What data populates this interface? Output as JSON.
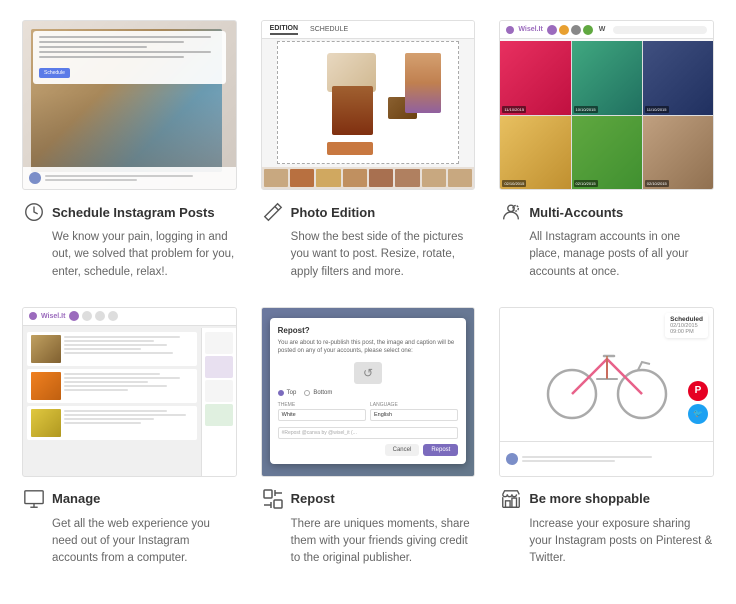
{
  "features": [
    {
      "id": "schedule",
      "title": "Schedule Instagram Posts",
      "description": "We know your pain, logging in and out, we solved that problem for you, enter, schedule, relax!.",
      "icon": "clock-icon"
    },
    {
      "id": "photo-edition",
      "title": "Photo Edition",
      "description": "Show the best side of the pictures you want to post. Resize, rotate, apply filters and more.",
      "icon": "pencil-icon",
      "tab_edition": "EDITION",
      "tab_schedule": "SCHEDULE"
    },
    {
      "id": "multi-accounts",
      "title": "Multi-Accounts",
      "description": "All Instagram accounts in one place, manage posts of all your accounts at once.",
      "icon": "person-icon",
      "brand": "Wisel.It"
    },
    {
      "id": "manage",
      "title": "Manage",
      "description": "Get all the web experience you need out of your Instagram accounts from a computer.",
      "icon": "monitor-icon",
      "brand": "Wisel.It"
    },
    {
      "id": "repost",
      "title": "Repost",
      "description": "There are uniques moments, share them with your friends giving credit to the original publisher.",
      "icon": "repost-icon",
      "modal": {
        "title": "Repost?",
        "body": "You are about to re-publish this post, the image and caption will be posted on any of your accounts, please select one:",
        "handle": "@wisel #",
        "position_top": "Top",
        "position_bottom": "Bottom",
        "theme_label": "THEME",
        "theme_value": "White",
        "language_label": "LANGUAGE",
        "language_value": "English",
        "caption_label": "#Repost @canva by @wisel_it (...",
        "cancel_label": "Cancel",
        "repost_label": "Repost"
      }
    },
    {
      "id": "shoppable",
      "title": "Be more shoppable",
      "description": "Increase your exposure sharing your Instagram posts on Pinterest & Twitter.",
      "icon": "store-icon",
      "scheduled": {
        "label": "Scheduled",
        "date": "02/10/2015",
        "time": "09:00 PM"
      }
    }
  ],
  "ss3_images": [
    {
      "date": "11/10/2015",
      "time": "09:00:00"
    },
    {
      "date": "10/10/2015",
      "time": "09:00:00"
    },
    {
      "date": "11/10/2015",
      "time": "09:00:00"
    },
    {
      "date": "02/10/2015",
      "time": "09:00:00"
    },
    {
      "date": "02/10/2015",
      "time": "09:00:00"
    },
    {
      "date": "02/10/2015",
      "time": "09:00:00"
    }
  ]
}
